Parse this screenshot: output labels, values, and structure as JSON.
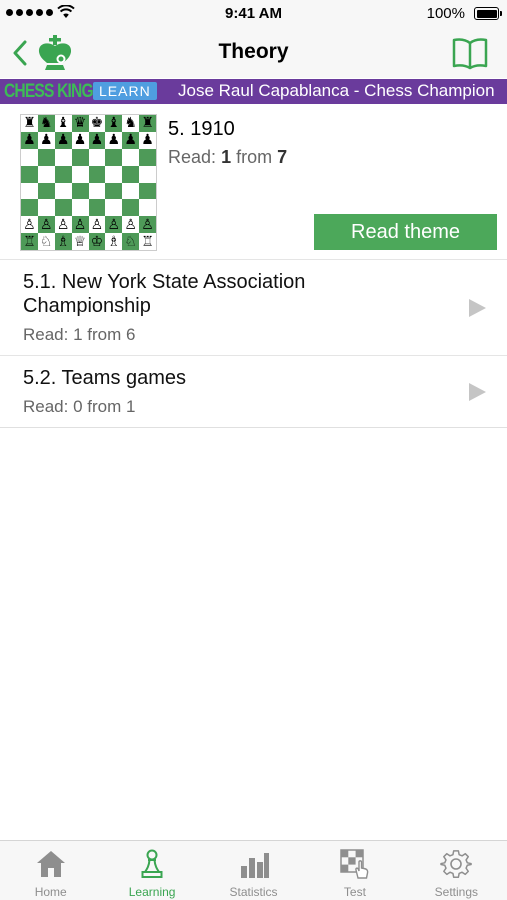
{
  "status_bar": {
    "time": "9:41 AM",
    "battery_percent": "100%"
  },
  "nav": {
    "title": "Theory",
    "back_icon": "chevron-left-icon",
    "logo_icon": "chess-king-logo-icon",
    "book_icon": "open-book-icon"
  },
  "banner": {
    "brand": "CHESS KING",
    "badge": "LEARN",
    "course_title": "Jose Raul Capablanca - Chess Champion"
  },
  "theme": {
    "title": "5. 1910",
    "progress_label": "Read:",
    "progress_read": "1",
    "progress_from": "from",
    "progress_total": "7",
    "read_button": "Read theme",
    "board_rows": [
      [
        "♜",
        "♞",
        "♝",
        "♛",
        "♚",
        "♝",
        "♞",
        "♜"
      ],
      [
        "♟",
        "♟",
        "♟",
        "♟",
        "♟",
        "♟",
        "♟",
        "♟"
      ],
      [
        "",
        "",
        "",
        "",
        "",
        "",
        "",
        ""
      ],
      [
        "",
        "",
        "",
        "",
        "",
        "",
        "",
        ""
      ],
      [
        "",
        "",
        "",
        "",
        "",
        "",
        "",
        ""
      ],
      [
        "",
        "",
        "",
        "",
        "",
        "",
        "",
        ""
      ],
      [
        "♙",
        "♙",
        "♙",
        "♙",
        "♙",
        "♙",
        "♙",
        "♙"
      ],
      [
        "♖",
        "♘",
        "♗",
        "♕",
        "♔",
        "♗",
        "♘",
        "♖"
      ]
    ]
  },
  "lessons": [
    {
      "title": "5.1. New York State Association Championship",
      "progress": "Read: 1 from 6"
    },
    {
      "title": "5.2. Teams games",
      "progress": "Read: 0 from 1"
    }
  ],
  "tabs": [
    {
      "label": "Home",
      "icon": "house-icon"
    },
    {
      "label": "Learning",
      "icon": "pawn-icon",
      "active": true
    },
    {
      "label": "Statistics",
      "icon": "bar-chart-icon"
    },
    {
      "label": "Test",
      "icon": "checkered-board-hand-icon"
    },
    {
      "label": "Settings",
      "icon": "gear-icon"
    }
  ],
  "colors": {
    "accent_green": "#4ca85a",
    "banner_purple": "#6a3b9c",
    "tab_active": "#3aa551",
    "tab_inactive": "#8e8e8e"
  }
}
